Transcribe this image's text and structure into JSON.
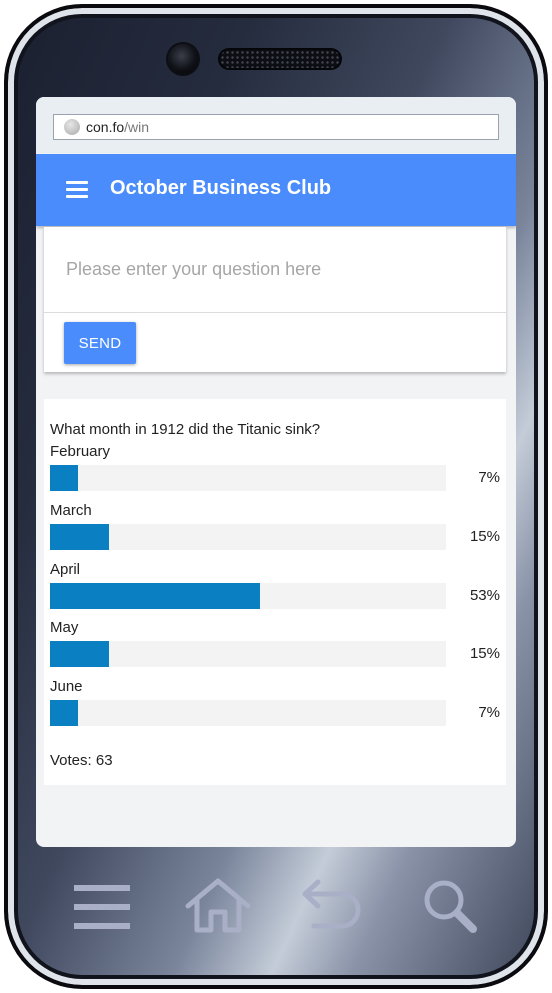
{
  "browser": {
    "url_host": "con.fo",
    "url_path": "/win"
  },
  "appbar": {
    "title": "October Business Club"
  },
  "question_card": {
    "placeholder": "Please enter your question here",
    "send_label": "SEND"
  },
  "poll": {
    "question": "What month in 1912 did the Titanic sink?",
    "options": [
      {
        "label": "February",
        "percent_text": "7%",
        "fraction": 0.07
      },
      {
        "label": "March",
        "percent_text": "15%",
        "fraction": 0.15
      },
      {
        "label": "April",
        "percent_text": "53%",
        "fraction": 0.53
      },
      {
        "label": "May",
        "percent_text": "15%",
        "fraction": 0.15
      },
      {
        "label": "June",
        "percent_text": "7%",
        "fraction": 0.07
      }
    ],
    "votes_text": "Votes: 63"
  },
  "colors": {
    "accent": "#4a8cfb",
    "bar": "#0a7fc2"
  },
  "phone_nav": [
    "menu-icon",
    "home-icon",
    "back-icon",
    "search-icon"
  ]
}
